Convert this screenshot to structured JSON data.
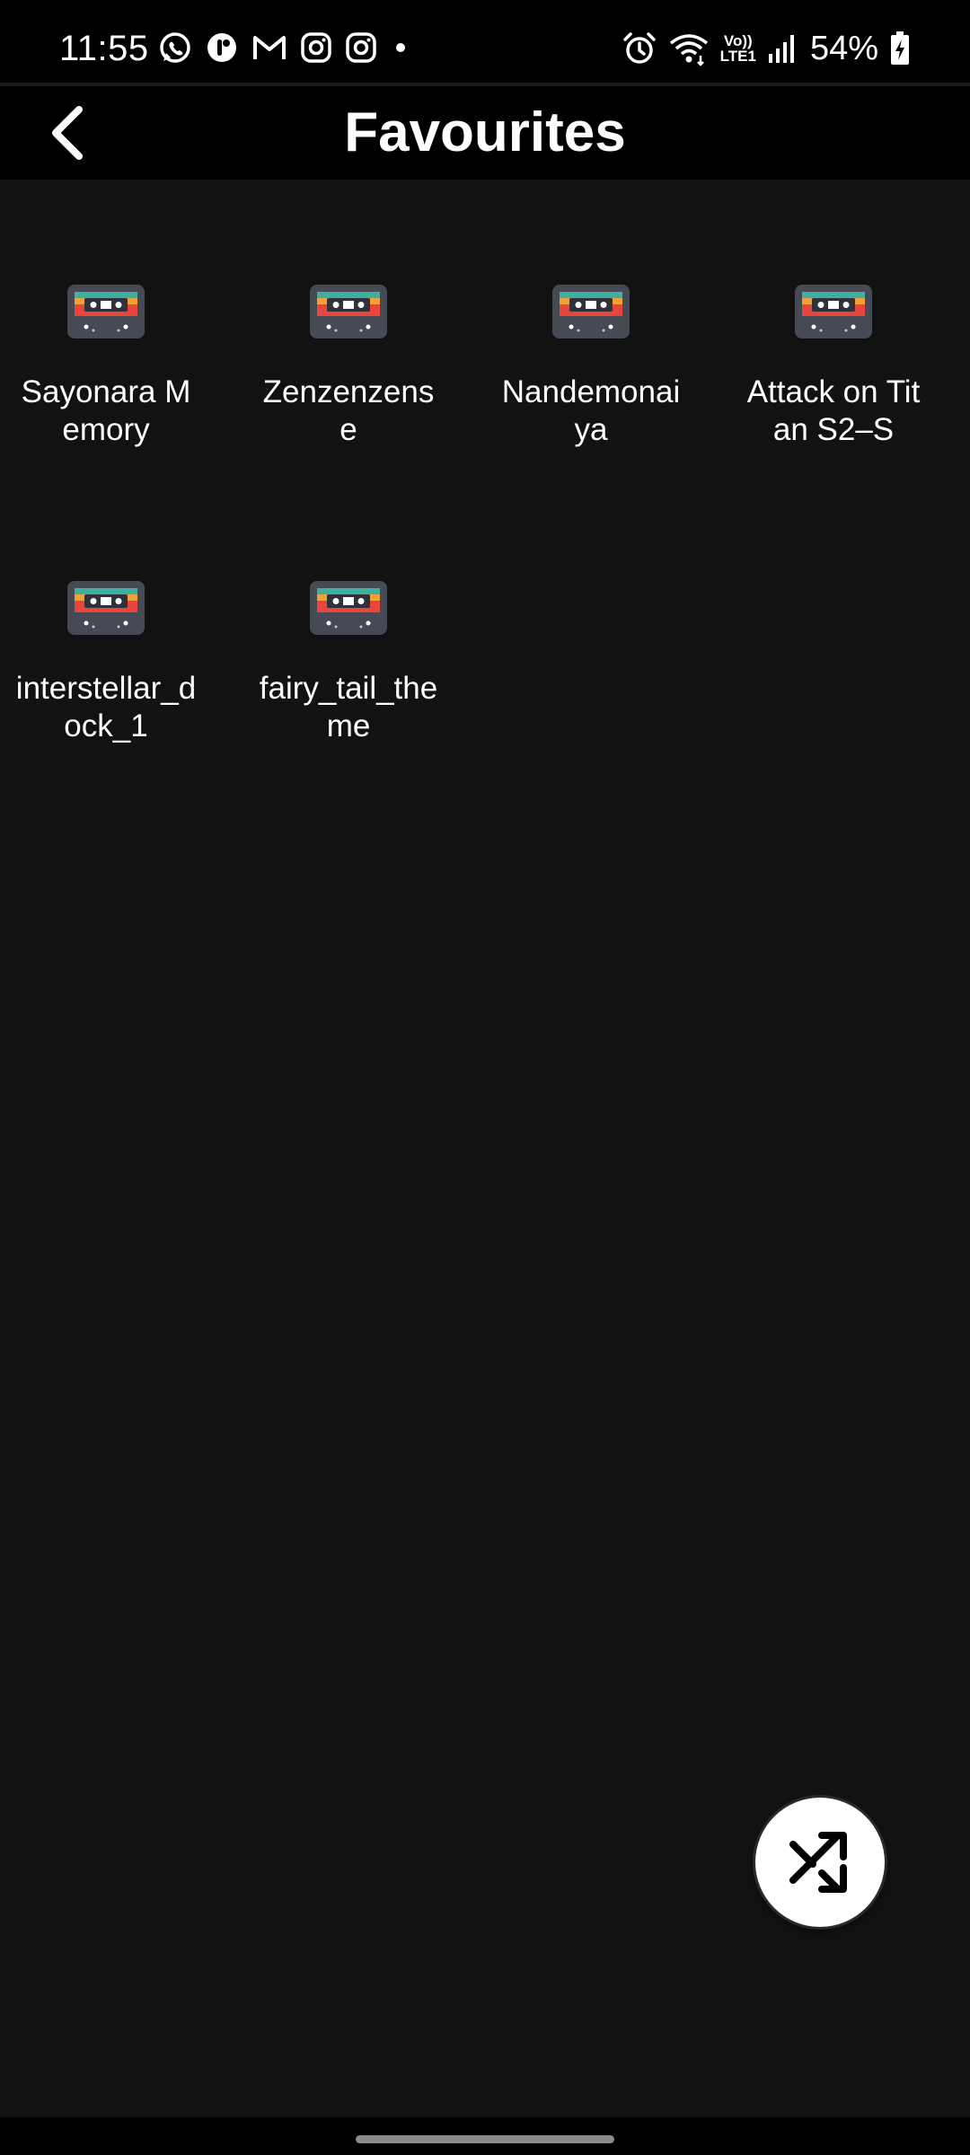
{
  "status_bar": {
    "time": "11:55",
    "left_icons": [
      "whatsapp-icon",
      "messenger-icon",
      "gmail-icon",
      "instagram-icon",
      "instagram-icon",
      "dot-icon"
    ],
    "right_icons": [
      "alarm-icon",
      "wifi-icon",
      "volte-lte-icon",
      "signal-icon",
      "battery-charging-icon"
    ],
    "network_label_top": "Vo))",
    "network_label_bottom": "LTE1",
    "battery": "54%"
  },
  "header": {
    "title": "Favourites",
    "back_icon": "chevron-left-icon"
  },
  "favourites": [
    {
      "label": "Sayonara Memory",
      "icon": "cassette-icon"
    },
    {
      "label": "Zenzenzense",
      "icon": "cassette-icon"
    },
    {
      "label": "Nandemonaiya",
      "icon": "cassette-icon"
    },
    {
      "label": "Attack on Titan S2–S",
      "icon": "cassette-icon"
    },
    {
      "label": "interstellar_dock_1",
      "icon": "cassette-icon"
    },
    {
      "label": "fairy_tail_theme",
      "icon": "cassette-icon"
    }
  ],
  "fab": {
    "icon": "shuffle-icon"
  },
  "colors": {
    "background": "#121212",
    "bar": "#000000",
    "text": "#ffffff",
    "cassette_body": "#454a55",
    "stripe_red": "#e8453c",
    "stripe_orange": "#f3a03a",
    "stripe_teal": "#3fb0a0"
  }
}
